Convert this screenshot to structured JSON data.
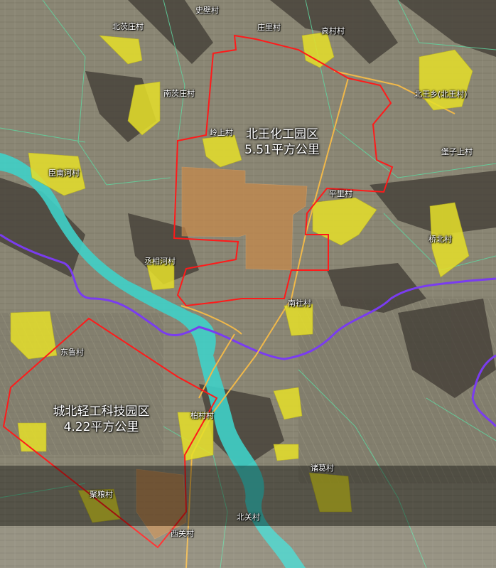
{
  "zones": [
    {
      "name": "北王化工园区",
      "area": "5.51平方公里",
      "boundary_color": "#ff1a1a"
    },
    {
      "name": "城北轻工科技园区",
      "area": "4.22平方公里",
      "boundary_color": "#ff1a1a"
    }
  ],
  "villages": [
    "史壁村",
    "庄里村",
    "高村村",
    "北茨庄村",
    "南茨庄村",
    "北王乡(北王村)",
    "岭上村",
    "堡子上村",
    "臣南河村",
    "平里村",
    "桥北村",
    "丞相河村",
    "南社村",
    "东鲁村",
    "柏村村",
    "诸葛村",
    "聚粮村",
    "北关村",
    "西关村"
  ],
  "colors": {
    "zone_boundary": "#ff1a1a",
    "road": "#f0b84a",
    "river": "#3fd0c8",
    "admin_boundary": "#7a3cf0",
    "settlement": "#e6e02a",
    "planned_land": "#c8894a"
  }
}
